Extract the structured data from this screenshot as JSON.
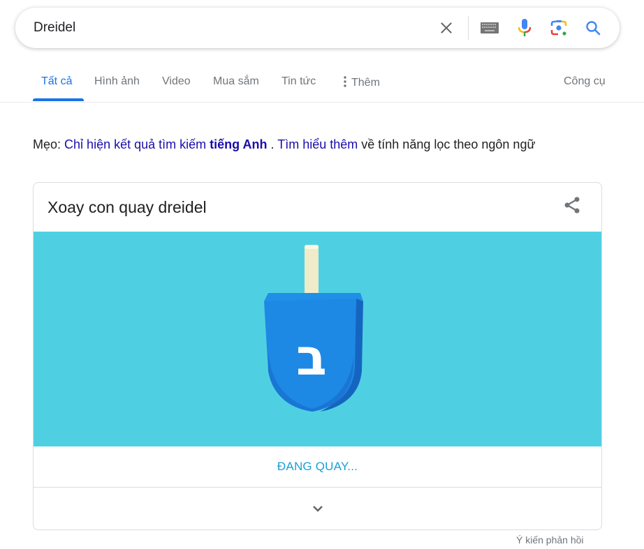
{
  "search": {
    "query": "Dreidel",
    "icons": [
      "clear-icon",
      "keyboard-icon",
      "microphone-icon",
      "google-lens-icon",
      "search-icon"
    ]
  },
  "tabs": {
    "items": [
      {
        "label": "Tất cả",
        "active": true
      },
      {
        "label": "Hình ảnh",
        "active": false
      },
      {
        "label": "Video",
        "active": false
      },
      {
        "label": "Mua sắm",
        "active": false
      },
      {
        "label": "Tin tức",
        "active": false
      },
      {
        "label": "Thêm",
        "active": false,
        "icon": "more-vert-icon"
      }
    ],
    "tools_label": "Công cụ"
  },
  "tip": {
    "prefix": "Mẹo:",
    "link1": "Chỉ hiện kết quả tìm kiếm",
    "link1_bold": "tiếng Anh",
    "separator": ".",
    "link2": "Tìm hiểu thêm",
    "suffix": "về tính năng lọc theo ngôn ngữ"
  },
  "card": {
    "title": "Xoay con quay dreidel",
    "share_icon": "share-icon",
    "dreidel_letter": "ב",
    "status": "ĐANG QUAY...",
    "expand_icon": "chevron-down-icon"
  },
  "feedback_label": "Ý kiến phản hồi",
  "colors": {
    "accent": "#1a73e8",
    "link": "#1a0dab",
    "stage_bg": "#4fd0e2",
    "dreidel_blue": "#1e88e5",
    "status_text": "#1a9fd6"
  }
}
